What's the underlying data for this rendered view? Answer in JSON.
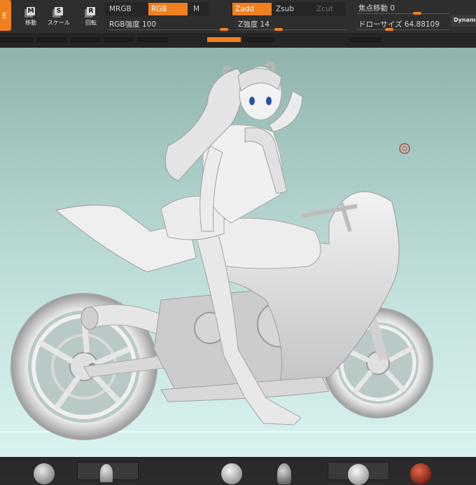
{
  "toolbar": {
    "active_tool_glyph": "E",
    "tools": [
      {
        "key": "M",
        "label": "移動"
      },
      {
        "key": "S",
        "label": "スケール"
      },
      {
        "key": "R",
        "label": "回転"
      }
    ],
    "color_buttons": {
      "mrgb": "MRGB",
      "rgb": "RGB",
      "m": "M"
    },
    "z_buttons": {
      "zadd": "Zadd",
      "zsub": "Zsub",
      "zcut": "Zcut"
    },
    "rgb_intensity": {
      "label": "RGB強度 100",
      "value": 100
    },
    "z_intensity": {
      "label": "Z強度 14",
      "value": 14
    },
    "focal_shift": {
      "label": "焦点移動 0",
      "value": 0
    },
    "draw_size": {
      "label": "ドローサイズ 64.88109",
      "value": 64.88109
    },
    "dynamic": "Dynamic"
  },
  "viewport": {
    "icons": {
      "cursor": "brush-cursor-icon",
      "model": "figure-on-motorcycle-model"
    }
  },
  "materials": {
    "items": [
      "gray-matcap-ball",
      "gray-horn-brush",
      "white-matcap-ball",
      "gray-cone-brush",
      "white-matcap-ball",
      "red-wax-ball"
    ],
    "colors": {
      "accent": "#f0801e",
      "red_material": "#a8321e"
    }
  }
}
